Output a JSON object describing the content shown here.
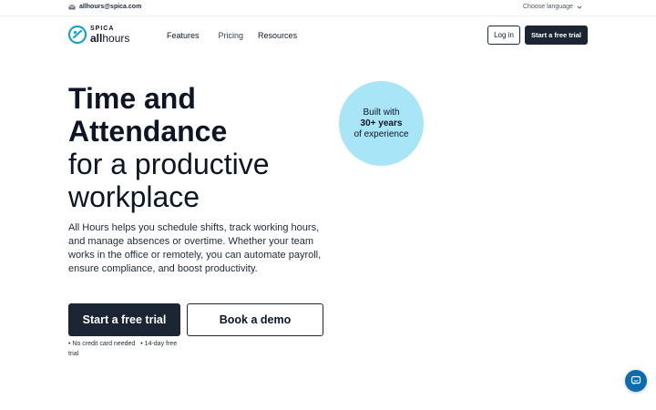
{
  "topbar": {
    "email": "allhours@spica.com",
    "email_icon": "mail-icon",
    "language_label": "Choose language",
    "language_icon": "chevron-down-icon"
  },
  "header": {
    "logo": {
      "brand": "SPICA",
      "product_bold": "all",
      "product_rest": "hours",
      "icon": "logo-mark-icon"
    },
    "nav": [
      "Features",
      "Pricing",
      "Resources"
    ],
    "login_label": "Log in",
    "trial_label": "Start a free trial"
  },
  "hero": {
    "title_bold_1": "Time and",
    "title_bold_2": "Attendance",
    "title_light_1": "for a productive",
    "title_light_2": "workplace",
    "description": "All Hours helps you schedule shifts, track working hours, and manage absences or overtime. Whether your team works in the office or remotely, you can automate payroll, ensure compliance, and boost productivity.",
    "cta_primary": "Start a free trial",
    "cta_secondary": "Book a demo",
    "note_1": "• No credit card needed",
    "note_2": "• 14-day free trial"
  },
  "badge": {
    "line1": "Built with",
    "line2": "30+ years",
    "line3": "of experience"
  },
  "chat": {
    "icon": "chat-icon"
  },
  "colors": {
    "primary_dark": "#1c2534",
    "badge_bg": "#a8e5f7",
    "chat_bg": "#0a6db0",
    "logo_teal": "#1aa3c8"
  }
}
